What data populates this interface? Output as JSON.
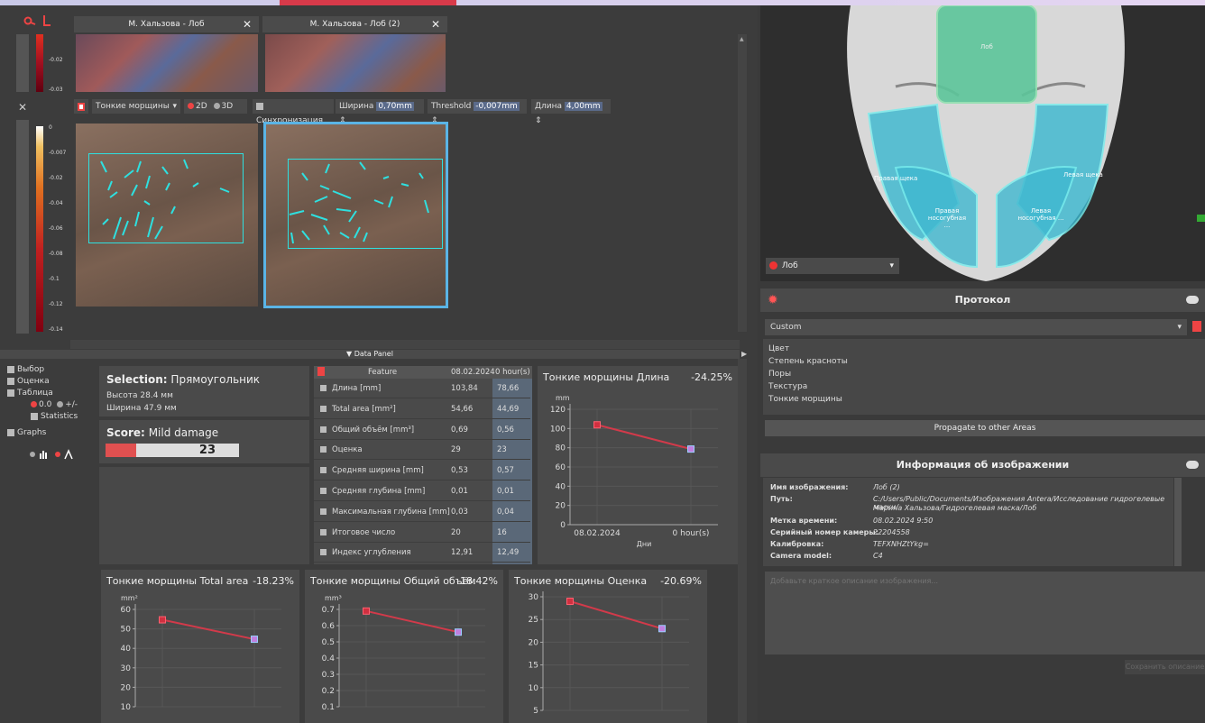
{
  "tabs": [
    {
      "title": "М. Хальзова - Лоб"
    },
    {
      "title": "М. Хальзова - Лоб (2)"
    }
  ],
  "scale_top": {
    "ticks": [
      "-0.02",
      "-0.03"
    ]
  },
  "toolbar": {
    "mode": "Тонкие морщины",
    "d2": "2D",
    "d3": "3D",
    "sync": "Синхронизация",
    "width_label": "Ширина",
    "width_value": "0,70mm",
    "threshold_label": "Threshold",
    "threshold_value": "-0,007mm",
    "length_label": "Длина",
    "length_value": "4,00mm"
  },
  "scale_left": {
    "ticks": [
      "0",
      "-0.007",
      "-0.02",
      "-0.04",
      "-0.06",
      "-0.08",
      "-0.1",
      "-0.12",
      "-0.14"
    ]
  },
  "data_panel_label": "▼ Data Panel",
  "options": {
    "select": "Выбор",
    "score": "Оценка",
    "table": "Таблица",
    "val": "0.0",
    "plusminus": "+/-",
    "stats": "Statistics",
    "graphs": "Graphs"
  },
  "selection": {
    "title": "Selection:",
    "shape": "Прямоугольник",
    "height_label": "Высота",
    "height": "28.4 мм",
    "width_label": "Ширина",
    "width": "47.9 мм"
  },
  "score": {
    "title": "Score:",
    "label": "Mild damage",
    "value": "23",
    "level": 0.23
  },
  "table": {
    "headers": [
      "Feature",
      "08.02.2024",
      "0 hour(s)"
    ],
    "rows": [
      [
        "Длина [mm]",
        "103,84",
        "78,66"
      ],
      [
        "Total area [mm²]",
        "54,66",
        "44,69"
      ],
      [
        "Общий объём [mm³]",
        "0,69",
        "0,56"
      ],
      [
        "Оценка",
        "29",
        "23"
      ],
      [
        "Средняя ширина [mm]",
        "0,53",
        "0,57"
      ],
      [
        "Средняя глубина [mm]",
        "0,01",
        "0,01"
      ],
      [
        "Максимальная глубина [mm]",
        "0,03",
        "0,04"
      ],
      [
        "Итоговое число",
        "20",
        "16"
      ],
      [
        "Индекс углубления",
        "12,91",
        "12,49"
      ]
    ]
  },
  "chart_data": [
    {
      "type": "line",
      "title": "Тонкие морщины Длина",
      "pct": "-24.25%",
      "ylabel": "mm",
      "xlabel": "Дни",
      "categories": [
        "08.02.2024",
        "0 hour(s)"
      ],
      "values": [
        103.84,
        78.66
      ],
      "ylim": [
        0,
        120
      ],
      "yticks": [
        "0",
        "20",
        "40",
        "60",
        "80",
        "100",
        "120"
      ]
    },
    {
      "type": "line",
      "title": "Тонкие морщины Total area",
      "pct": "-18.23%",
      "ylabel": "mm²",
      "categories": [
        "08.02.2024",
        "0 hour(s)"
      ],
      "values": [
        54.66,
        44.69
      ],
      "ylim": [
        10,
        60
      ],
      "yticks": [
        "10",
        "20",
        "30",
        "40",
        "50",
        "60"
      ]
    },
    {
      "type": "line",
      "title": "Тонкие морщины Общий объём",
      "pct": "-18.42%",
      "ylabel": "mm³",
      "categories": [
        "08.02.2024",
        "0 hour(s)"
      ],
      "values": [
        0.69,
        0.56
      ],
      "ylim": [
        0.1,
        0.7
      ],
      "yticks": [
        "0.1",
        "0.2",
        "0.3",
        "0.4",
        "0.5",
        "0.6",
        "0.7"
      ]
    },
    {
      "type": "line",
      "title": "Тонкие морщины Оценка",
      "pct": "-20.69%",
      "categories": [
        "08.02.2024",
        "0 hour(s)"
      ],
      "values": [
        29,
        23
      ],
      "ylim": [
        5,
        30
      ],
      "yticks": [
        "5",
        "10",
        "15",
        "20",
        "25",
        "30"
      ]
    }
  ],
  "face": {
    "zones": [
      "Лоб",
      "Правая щека",
      "Левая щека",
      "Правая носогубная ...",
      "Левая носогубная ..."
    ],
    "zone_select": "Лоб"
  },
  "protocol": {
    "title": "Протокол",
    "preset": "Custom",
    "items": [
      "Цвет",
      "Степень красноты",
      "Поры",
      "Текстура",
      "Тонкие морщины"
    ],
    "propagate": "Propagate to other Areas"
  },
  "image_info": {
    "title": "Информация об изображении",
    "rows": [
      [
        "Имя изображения:",
        "Лоб (2)"
      ],
      [
        "Путь:",
        "C:/Users/Public/Documents/Изображения Antera/Исследование гидрогелевые маски/\nМарина Хальзова/Гидрогелевая маска/Лоб"
      ],
      [
        "Метка времени:",
        "08.02.2024 9:50"
      ],
      [
        "Серийный номер камеры:",
        "22204558"
      ],
      [
        "Калибровка:",
        "TEFXNHZtYkg="
      ],
      [
        "Camera model:",
        "C4"
      ]
    ],
    "placeholder": "Добавьте краткое описание изображения...",
    "save": "Сохранить описание"
  },
  "colors": {
    "accent": "#5ab4e6",
    "line": "#d23a4a",
    "cyan": "#2ee0e0"
  }
}
